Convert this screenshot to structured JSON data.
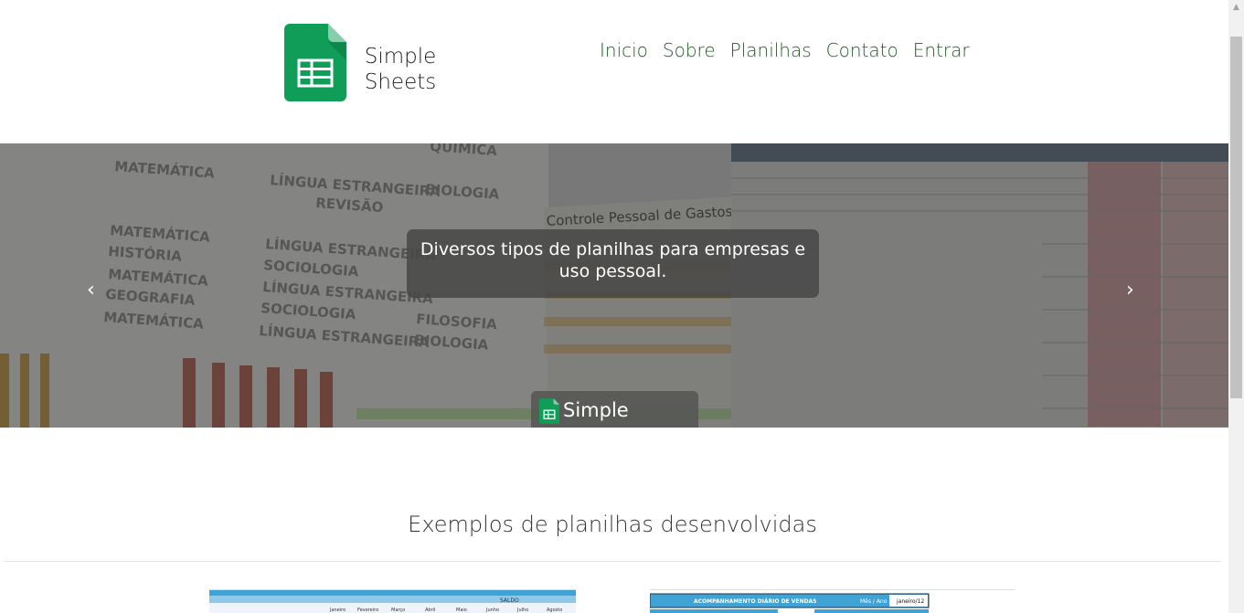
{
  "brand": {
    "line1": "Simple",
    "line2": "Sheets",
    "color": "#0f9d58"
  },
  "nav": [
    {
      "label": "Inicio"
    },
    {
      "label": "Sobre"
    },
    {
      "label": "Planilhas"
    },
    {
      "label": "Contato"
    },
    {
      "label": "Entrar"
    }
  ],
  "hero": {
    "caption": "Diversos tipos de planilhas para empresas e uso pessoal.",
    "badge": "Simple Sheets",
    "prev_icon": "‹",
    "next_icon": "›",
    "background_words": [
      "MATEMÁTICA",
      "LÍNGUA ESTRANGEIRA",
      "BIOLOGIA",
      "REVISÃO",
      "HISTÓRIA",
      "SOCIOLOGIA",
      "GEOGRAFIA",
      "QUÍMICA",
      "FILOSOFIA",
      "Controle Pessoal de Gastos Mensais"
    ]
  },
  "section": {
    "title": "Exemplos de planilhas desenvolvidas"
  },
  "thumbs": [
    {
      "header": "SALDO",
      "months": [
        "Janeiro",
        "Fevereiro",
        "Março",
        "Abril",
        "Maio",
        "Junho",
        "Julho",
        "Agosto"
      ]
    },
    {
      "header": "ACOMPANHAMENTO DIÁRIO DE VENDAS",
      "label": "Mês / Ano",
      "value": "janeiro/12"
    }
  ],
  "colors": {
    "nav": "#1b5e20",
    "sheet_green": "#0f9d58",
    "accent_blue": "#3fa3d6"
  }
}
